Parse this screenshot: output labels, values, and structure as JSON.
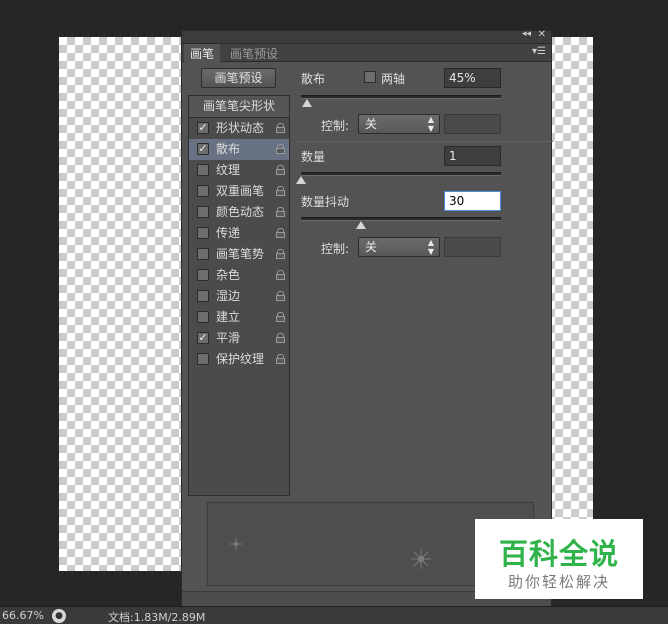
{
  "panel": {
    "tabs": [
      "画笔",
      "画笔预设"
    ],
    "preset_button": "画笔预设",
    "list_header": "画笔笔尖形状",
    "items": [
      {
        "label": "形状动态",
        "checked": true
      },
      {
        "label": "散布",
        "checked": true,
        "selected": true
      },
      {
        "label": "纹理",
        "checked": false
      },
      {
        "label": "双重画笔",
        "checked": false
      },
      {
        "label": "颜色动态",
        "checked": false
      },
      {
        "label": "传递",
        "checked": false
      },
      {
        "label": "画笔笔势",
        "checked": false
      },
      {
        "label": "杂色",
        "checked": false
      },
      {
        "label": "湿边",
        "checked": false
      },
      {
        "label": "建立",
        "checked": false
      },
      {
        "label": "平滑",
        "checked": true
      },
      {
        "label": "保护纹理",
        "checked": false
      }
    ],
    "scatter": {
      "label": "散布",
      "both_axes_label": "两轴",
      "both_axes_checked": false,
      "value": "45%",
      "slider_fraction": 0.03,
      "control_label": "控制:",
      "control_value": "关"
    },
    "count": {
      "label": "数量",
      "value": "1",
      "slider_fraction": 0.0
    },
    "count_jitter": {
      "label": "数量抖动",
      "value": "30",
      "slider_fraction": 0.3,
      "control_label": "控制:",
      "control_value": "关"
    }
  },
  "statusbar": {
    "zoom": "66.67%",
    "doc_info": "文档:1.83M/2.89M"
  },
  "watermark": {
    "title": "百科全说",
    "subtitle": "助你轻松解决"
  },
  "check_mark": "✓"
}
